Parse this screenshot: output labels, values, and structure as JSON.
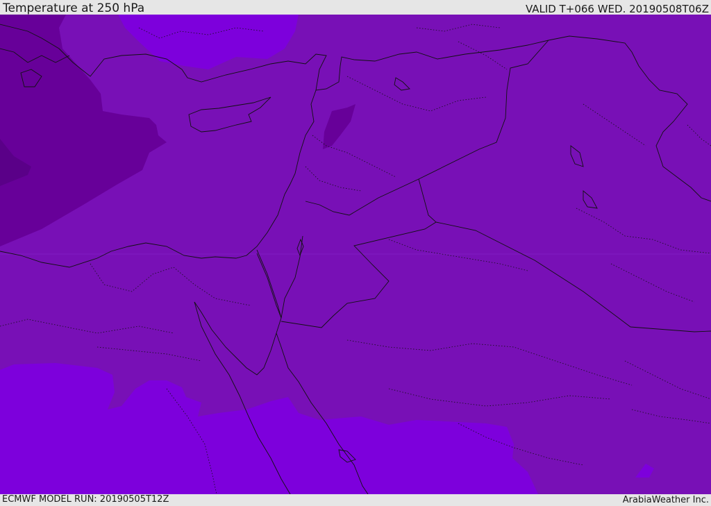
{
  "header": {
    "title": "Temperature at 250 hPa",
    "valid": "VALID T+066 WED. 20190508T06Z"
  },
  "footer": {
    "model_run": "ECMWF MODEL RUN: 20190505T12Z",
    "credit": "ArabiaWeather Inc."
  },
  "colors": {
    "background_panel": "#e6e6e6",
    "temp_band_warmest": "#7d00dc",
    "temp_band_mid": "#7810b6",
    "temp_band_cool": "#670099",
    "temp_band_coldest": "#5a0088",
    "borders": "#111111"
  }
}
